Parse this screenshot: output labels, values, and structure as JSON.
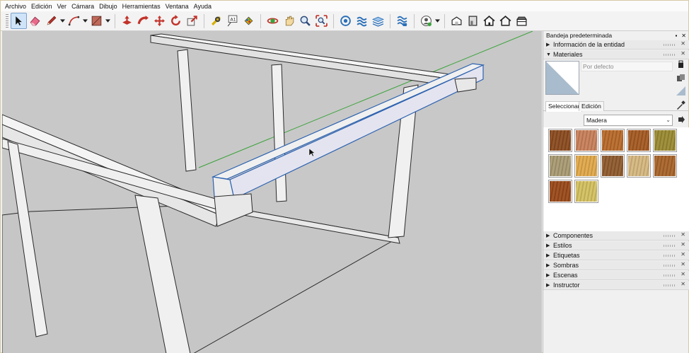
{
  "menu": [
    "Archivo",
    "Edición",
    "Ver",
    "Cámara",
    "Dibujo",
    "Herramientas",
    "Ventana",
    "Ayuda"
  ],
  "toolbar": {
    "tools": [
      "select-icon",
      "eraser-icon",
      "pencil-icon",
      "arc-icon",
      "shape-icon",
      "push-pull-icon",
      "follow-me-icon",
      "move-icon",
      "rotate-icon",
      "scale-icon",
      "tape-measure-icon",
      "text-icon",
      "paint-bucket-icon",
      "orbit-icon",
      "pan-icon",
      "zoom-icon",
      "zoom-extents-icon",
      "warehouse-icon",
      "extension-warehouse-icon",
      "layout-icon",
      "sandbox-icon",
      "user-icon",
      "iso-view-icon",
      "front-view-icon",
      "home-icon",
      "house-outline-icon",
      "top-view-icon"
    ]
  },
  "tray": {
    "title": "Bandeja predeterminada",
    "entity_info_label": "Información de la entidad",
    "materials_label": "Materiales",
    "material_name": "Por defecto",
    "tab_select": "Seleccionar",
    "tab_edit": "Edición",
    "collection": "Madera",
    "swatch_colors": [
      "#8b4c20",
      "#c8805a",
      "#b86a2a",
      "#a55a22",
      "#9a8a32",
      "#a89a72",
      "#e0a84a",
      "#8f5a2e",
      "#d6b880",
      "#a8642a",
      "#9a4a1a",
      "#d4c060"
    ],
    "collapsed_panels": [
      "Componentes",
      "Estilos",
      "Etiquetas",
      "Sombras",
      "Escenas",
      "Instructor"
    ]
  },
  "colors": {
    "viewport_bg": "#c8c8c8",
    "wood_beam": "#f2f2f2",
    "selected_blue": "#2d63b0",
    "axis_green": "#3aa23a"
  }
}
